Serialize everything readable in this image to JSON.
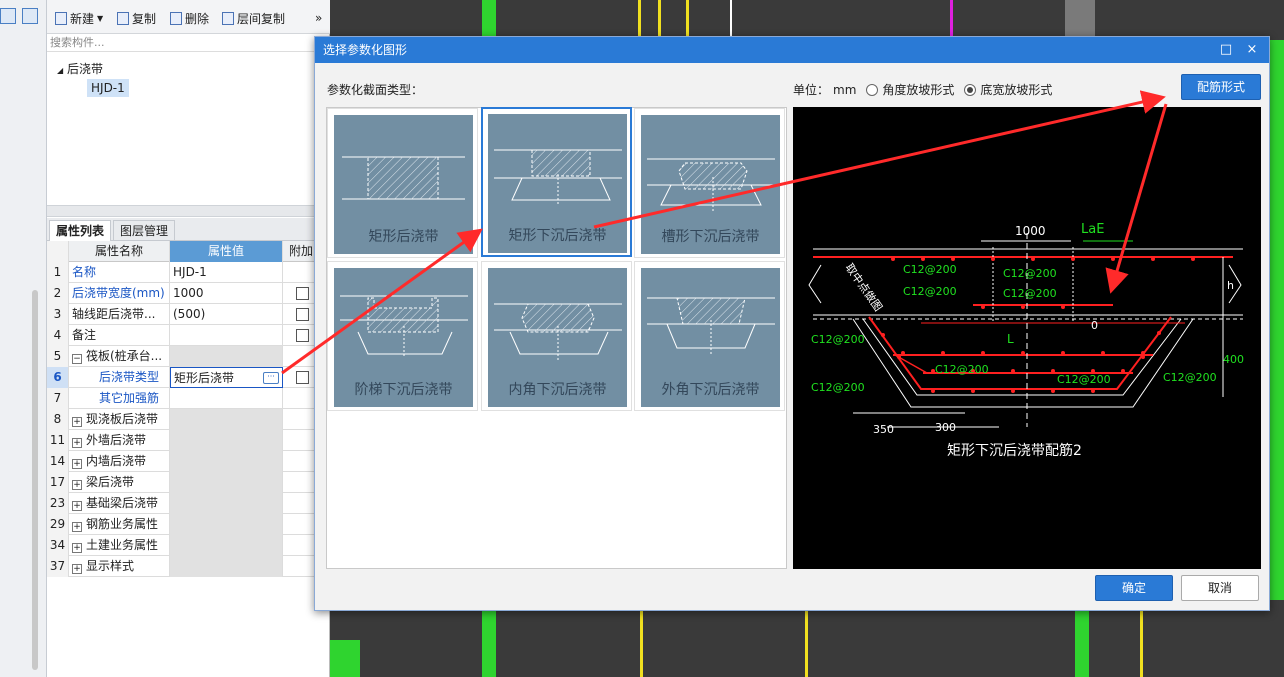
{
  "toolbar": {
    "new_label": "新建",
    "copy_label": "复制",
    "delete_label": "删除",
    "floor_copy_label": "层间复制",
    "more_glyph": "»"
  },
  "search": {
    "placeholder": "搜索构件..."
  },
  "tree": {
    "root_label": "后浇带",
    "child_label": "HJD-1"
  },
  "prop_tabs": [
    "属性列表",
    "图层管理"
  ],
  "prop_table": {
    "headers": {
      "name": "属性名称",
      "value": "属性值",
      "add": "附加"
    },
    "rows": [
      {
        "num": "1",
        "name": "名称",
        "value": "HJD-1"
      },
      {
        "num": "2",
        "name": "后浇带宽度(mm)",
        "value": "1000"
      },
      {
        "num": "3",
        "name": "轴线距后浇带...",
        "value": "(500)"
      },
      {
        "num": "4",
        "name": "备注",
        "value": ""
      },
      {
        "num": "5",
        "name": "筏板(桩承台...",
        "value": ""
      },
      {
        "num": "6",
        "name": "后浇带类型",
        "value": "矩形后浇带"
      },
      {
        "num": "7",
        "name": "其它加强筋",
        "value": ""
      },
      {
        "num": "8",
        "name": "现浇板后浇带",
        "value": ""
      },
      {
        "num": "11",
        "name": "外墙后浇带",
        "value": ""
      },
      {
        "num": "14",
        "name": "内墙后浇带",
        "value": ""
      },
      {
        "num": "17",
        "name": "梁后浇带",
        "value": ""
      },
      {
        "num": "23",
        "name": "基础梁后浇带",
        "value": ""
      },
      {
        "num": "29",
        "name": "钢筋业务属性",
        "value": ""
      },
      {
        "num": "34",
        "name": "土建业务属性",
        "value": ""
      },
      {
        "num": "37",
        "name": "显示样式",
        "value": ""
      }
    ],
    "ellipsis": "···"
  },
  "dialog": {
    "title": "选择参数化图形",
    "maximize_glyph": "□",
    "close_glyph": "×",
    "section_label": "参数化截面类型：",
    "unit_label": "单位：",
    "unit_value": "mm",
    "radio_angle": "角度放坡形式",
    "radio_width": "底宽放坡形式",
    "rebar_button": "配筋形式",
    "ok_button": "确定",
    "cancel_button": "取消",
    "shapes": [
      {
        "label": "矩形后浇带"
      },
      {
        "label": "矩形下沉后浇带"
      },
      {
        "label": "槽形下沉后浇带"
      },
      {
        "label": "阶梯下沉后浇带"
      },
      {
        "label": "内角下沉后浇带"
      },
      {
        "label": "外角下沉后浇带"
      }
    ],
    "preview": {
      "caption": "矩形下沉后浇带配筋2",
      "dim_1000": "1000",
      "dim_lae": "LaE",
      "rebar": "C12@200",
      "label_l": "L",
      "label_0": "0",
      "label_h": "h",
      "label_400": "400",
      "label_350": "350",
      "label_300": "300",
      "slope_note": "取中点做图"
    }
  },
  "colors": {
    "accent": "#2a7ad6",
    "header_blue": "#5b9bd5",
    "thumb_bg": "#728fa3",
    "arrow": "#ff2a2a",
    "cad_red": "#ff2020",
    "cad_green": "#20e020"
  }
}
